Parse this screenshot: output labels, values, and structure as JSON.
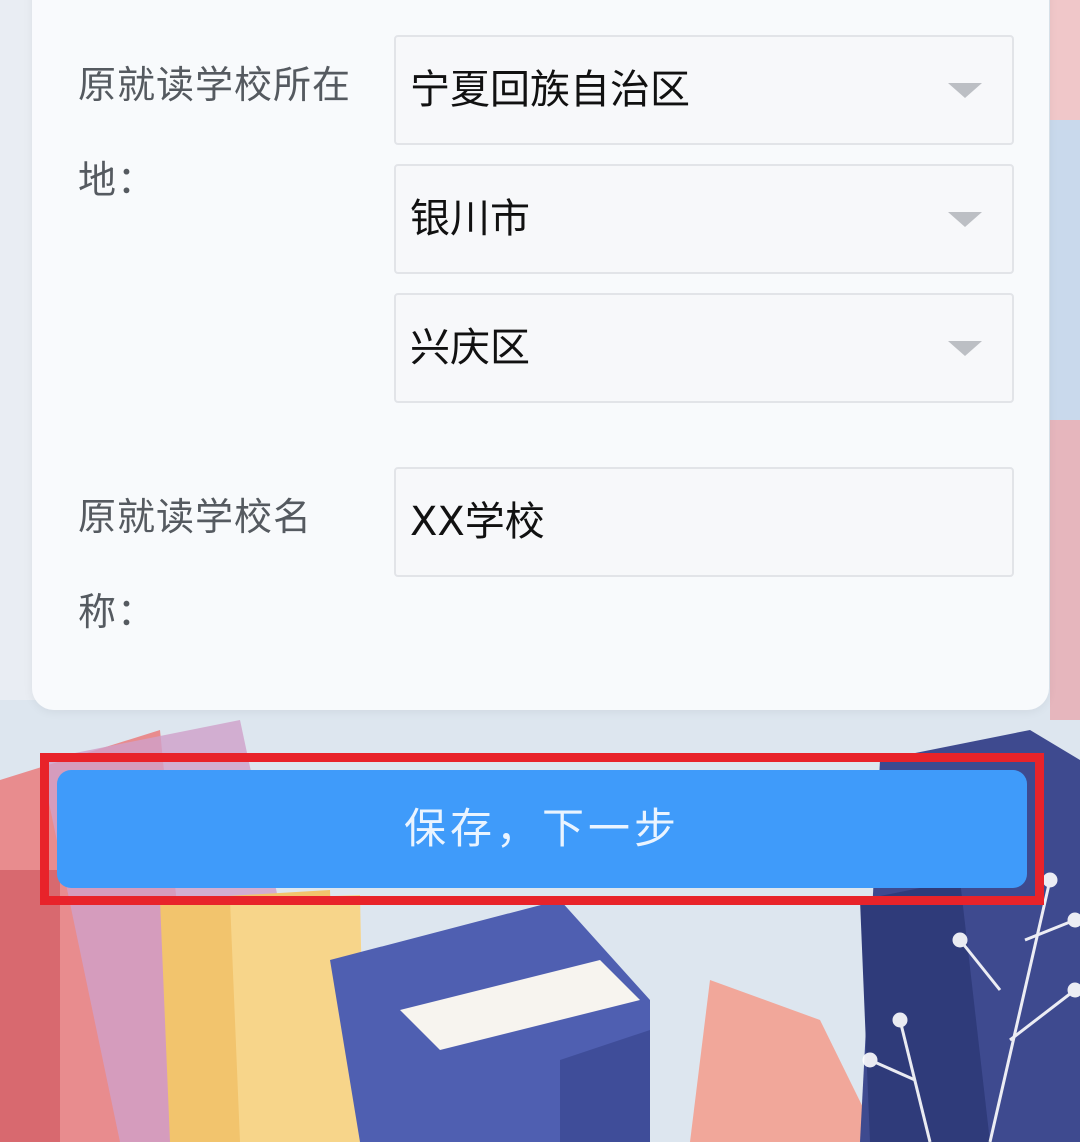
{
  "form": {
    "location_label": "原就读学校所在地：",
    "province_value": "宁夏回族自治区",
    "city_value": "银川市",
    "district_value": "兴庆区",
    "school_name_label": "原就读学校名称：",
    "school_name_value": "XX学校"
  },
  "actions": {
    "save_next_label": "保存，下一步"
  },
  "colors": {
    "button_blue": "#3f9bfa",
    "highlight_red": "#e8232a",
    "label_gray": "#555a60"
  }
}
